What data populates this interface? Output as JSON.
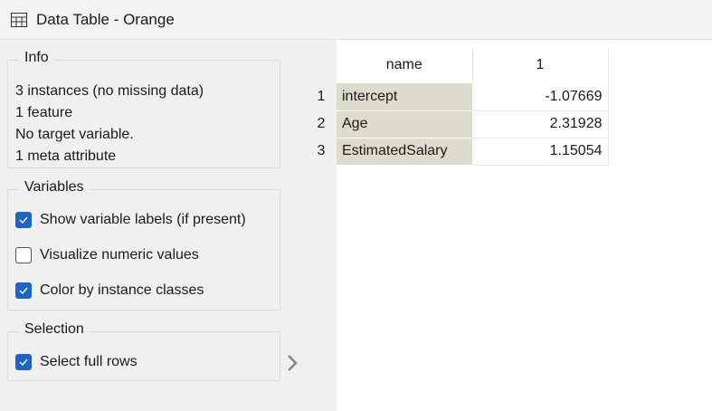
{
  "window": {
    "title": "Data Table - Orange",
    "icon": "table-icon"
  },
  "info": {
    "title": "Info",
    "lines": [
      "3 instances (no missing data)",
      "1 feature",
      "No target variable.",
      "1 meta attribute"
    ]
  },
  "variables": {
    "title": "Variables",
    "options": [
      {
        "label": "Show variable labels (if present)",
        "checked": true
      },
      {
        "label": "Visualize numeric values",
        "checked": false
      },
      {
        "label": "Color by instance classes",
        "checked": true
      }
    ]
  },
  "selection": {
    "title": "Selection",
    "options": [
      {
        "label": "Select full rows",
        "checked": true
      }
    ]
  },
  "table": {
    "columns": [
      "name",
      "1"
    ],
    "rows": [
      {
        "index": "1",
        "name": "intercept",
        "value": "-1.07669"
      },
      {
        "index": "2",
        "name": "Age",
        "value": "2.31928"
      },
      {
        "index": "3",
        "name": "EstimatedSalary",
        "value": "1.15054"
      }
    ]
  },
  "colors": {
    "accent": "#1f63c4",
    "meta_cell": "#dcdccc"
  }
}
